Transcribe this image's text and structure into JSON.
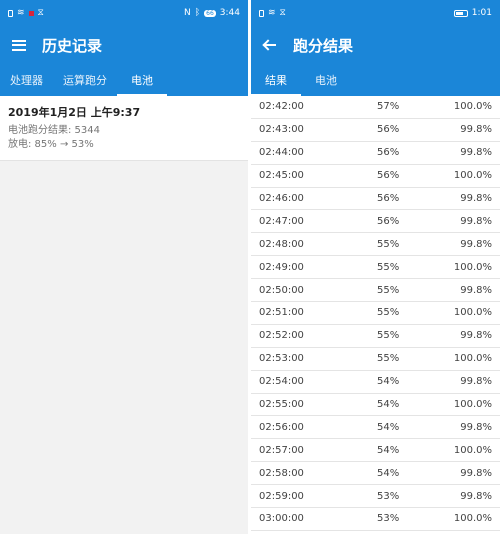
{
  "left": {
    "status": {
      "time": "3:44",
      "icons_left": [
        "sim-icon",
        "wifi-icon",
        "record-icon",
        "cast-icon"
      ],
      "icons_right": [
        "nfc-icon",
        "bluetooth-icon",
        "battery-icon"
      ],
      "battery_pill": "66"
    },
    "appbar": {
      "title": "历史记录"
    },
    "tabs": [
      {
        "label": "处理器"
      },
      {
        "label": "运算跑分"
      },
      {
        "label": "电池"
      }
    ],
    "active_tab": "电池",
    "entry": {
      "date": "2019年1月2日 上午9:37",
      "score": "电池跑分结果: 5344",
      "discharge": "放电: 85% → 53%"
    }
  },
  "right": {
    "status": {
      "time": "1:01",
      "icons_left": [
        "sim-icon",
        "wifi-icon",
        "cast-icon"
      ],
      "icons_right": [
        "battery-icon"
      ]
    },
    "appbar": {
      "title": "跑分结果"
    },
    "tabs": [
      {
        "label": "结果"
      },
      {
        "label": "电池"
      }
    ],
    "active_tab": "结果",
    "rows": [
      [
        "02:42:00",
        "57%",
        "100.0%"
      ],
      [
        "02:43:00",
        "56%",
        "99.8%"
      ],
      [
        "02:44:00",
        "56%",
        "99.8%"
      ],
      [
        "02:45:00",
        "56%",
        "100.0%"
      ],
      [
        "02:46:00",
        "56%",
        "99.8%"
      ],
      [
        "02:47:00",
        "56%",
        "99.8%"
      ],
      [
        "02:48:00",
        "55%",
        "99.8%"
      ],
      [
        "02:49:00",
        "55%",
        "100.0%"
      ],
      [
        "02:50:00",
        "55%",
        "99.8%"
      ],
      [
        "02:51:00",
        "55%",
        "100.0%"
      ],
      [
        "02:52:00",
        "55%",
        "99.8%"
      ],
      [
        "02:53:00",
        "55%",
        "100.0%"
      ],
      [
        "02:54:00",
        "54%",
        "99.8%"
      ],
      [
        "02:55:00",
        "54%",
        "100.0%"
      ],
      [
        "02:56:00",
        "54%",
        "99.8%"
      ],
      [
        "02:57:00",
        "54%",
        "100.0%"
      ],
      [
        "02:58:00",
        "54%",
        "99.8%"
      ],
      [
        "02:59:00",
        "53%",
        "99.8%"
      ],
      [
        "03:00:00",
        "53%",
        "100.0%"
      ]
    ]
  },
  "colors": {
    "primary": "#1b86d8",
    "divider": "#e4e4e4",
    "text": "#424242"
  }
}
